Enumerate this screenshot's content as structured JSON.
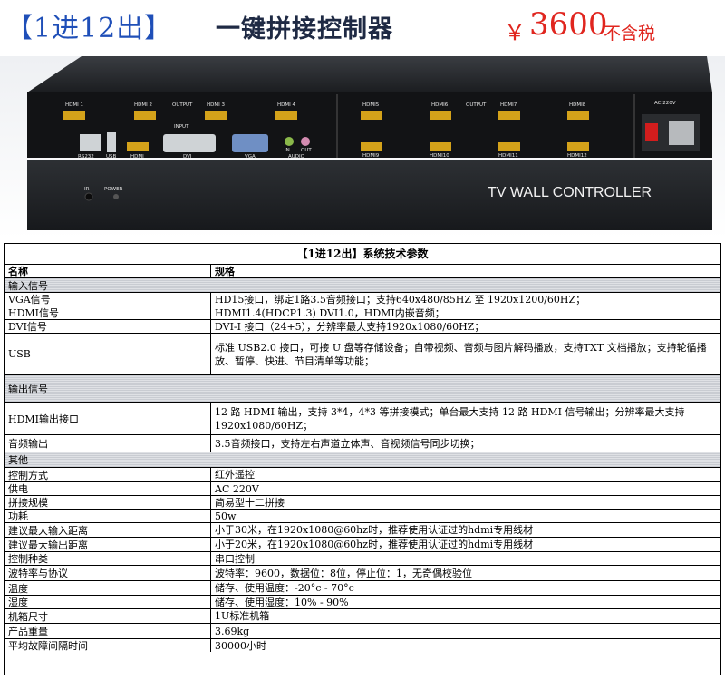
{
  "banner": {
    "title_bracket": "【1进12出】",
    "headline": "一键拼接控制器",
    "price_symbol": "￥",
    "price_value": "3600",
    "price_note": "不含税"
  },
  "device": {
    "top_labels": [
      "HDMI 1",
      "HDMI 2",
      "OUTPUT",
      "HDMI 3",
      "HDMI 4",
      "HDMI5",
      "HDMI6",
      "OUTPUT",
      "HDMI7",
      "HDMI8"
    ],
    "input_label": "INPUT",
    "bottom_labels": [
      "RS232",
      "USB",
      "HDMI",
      "DVI",
      "VGA",
      "IN",
      "OUT",
      "AUDIO",
      "HDMI9",
      "HDMI10",
      "HDMI11",
      "HDMI12"
    ],
    "power_label": "AC 220V",
    "ir_label": "IR",
    "power_led_label": "POWER",
    "front_label": "TV WALL CONTROLLER"
  },
  "spec": {
    "caption": "【1进12出】系统技术参数",
    "header": {
      "name": "名称",
      "spec": "规格"
    },
    "rows": [
      {
        "type": "section",
        "name": "输入信号"
      },
      {
        "name": "VGA信号",
        "value": "HD15接口，绑定1路3.5音频接口；支持640x480/85HZ 至 1920x1200/60HZ；"
      },
      {
        "name": "HDMI信号",
        "value": "HDMI1.4(HDCP1.3) DVI1.0，HDMI内嵌音频；"
      },
      {
        "name": "DVI信号",
        "value": "DVI-I 接口（24+5），分辨率最大支持1920x1080/60HZ；"
      },
      {
        "name": "USB",
        "value": "标准 USB2.0 接口，可接 U 盘等存储设备；自带视频、音频与图片解码播放，支持TXT 文档播放；支持轮循播放、暂停、快进、节目清单等功能；"
      },
      {
        "type": "section",
        "name": "输出信号"
      },
      {
        "name": "HDMI输出接口",
        "value": "12 路 HDMI 输出，支持 3*4，4*3 等拼接模式；单台最大支持 12 路 HDMI 信号输出；分辨率最大支持 1920x1080/60HZ；"
      },
      {
        "name": "音频输出",
        "value": "3.5音频接口，支持左右声道立体声、音视频信号同步切换；"
      },
      {
        "type": "section",
        "name": "其他"
      },
      {
        "name": "控制方式",
        "value": "红外遥控"
      },
      {
        "name": "供电",
        "value": "AC 220V"
      },
      {
        "name": "拼接规模",
        "value": "简易型十二拼接"
      },
      {
        "name": "功耗",
        "value": "50w"
      },
      {
        "name": "建议最大输入距离",
        "value": "小于30米，在1920x1080@60hz时，推荐使用认证过的hdmi专用线材"
      },
      {
        "name": "建议最大输出距离",
        "value": "小于20米，在1920x1080@60hz时，推荐使用认证过的hdmi专用线材"
      },
      {
        "name": "控制种类",
        "value": "串口控制"
      },
      {
        "name": "波特率与协议",
        "value": "波特率：9600，数据位：8位，停止位：1，无奇偶校验位"
      },
      {
        "name": "温度",
        "value": "储存、使用温度：-20°c - 70°c"
      },
      {
        "name": "湿度",
        "value": "储存、使用湿度：10% - 90%"
      },
      {
        "name": "机箱尺寸",
        "value": "1U标准机箱"
      },
      {
        "name": "产品重量",
        "value": "3.69kg"
      },
      {
        "name": "平均故障间隔时间",
        "value": "30000小时"
      }
    ]
  }
}
